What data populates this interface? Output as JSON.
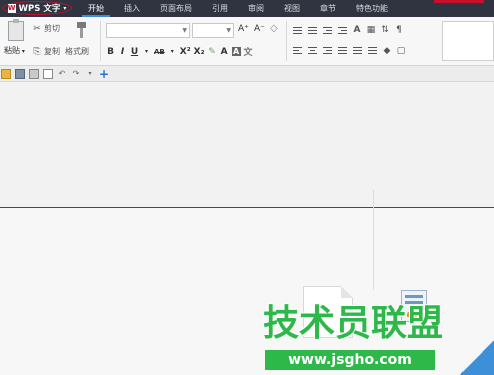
{
  "app": {
    "name": "WPS 文字",
    "logo_glyph": "W"
  },
  "tabs": [
    {
      "label": "开始",
      "active": true
    },
    {
      "label": "插入"
    },
    {
      "label": "页面布局"
    },
    {
      "label": "引用"
    },
    {
      "label": "审阅"
    },
    {
      "label": "视图"
    },
    {
      "label": "章节"
    },
    {
      "label": "特色功能"
    }
  ],
  "clipboard": {
    "paste_label": "粘贴",
    "cut_label": "剪切",
    "copy_label": "复制",
    "format_painter_label": "格式刷"
  },
  "font": {
    "buttons": [
      "B",
      "I",
      "U",
      "AB",
      "X²",
      "X₂",
      "A"
    ],
    "grow_label": "A⁺",
    "shrink_label": "A⁻"
  },
  "watermark": {
    "brand": "技术员联盟",
    "url": "www.jsgho.com"
  },
  "colors": {
    "menu_bar": "#2f3440",
    "accent_red": "#c8102e",
    "active_tab": "#3c8dde",
    "watermark_green": "#2fb84a"
  }
}
